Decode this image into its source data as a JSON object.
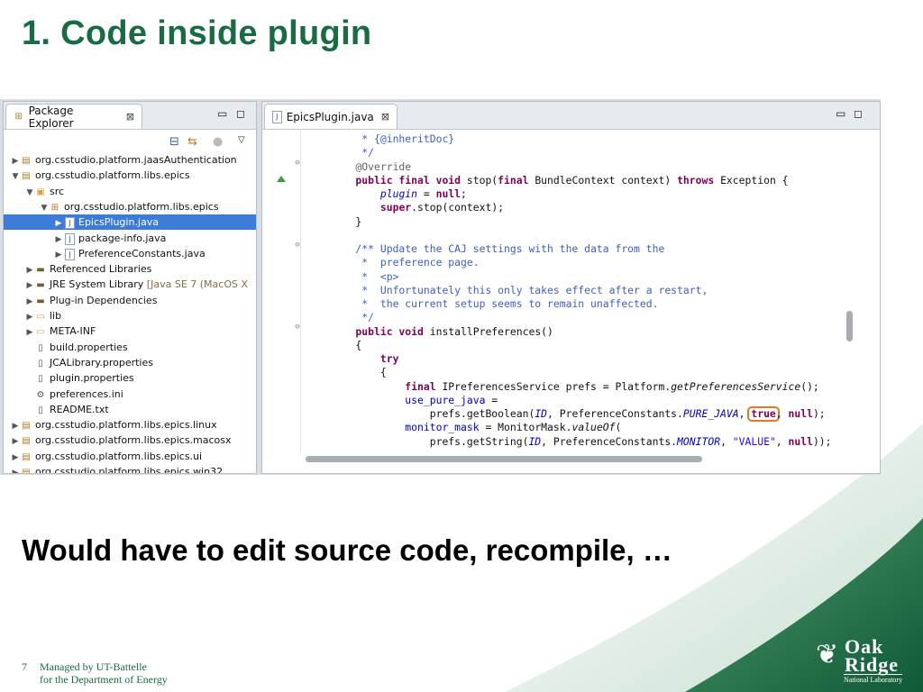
{
  "slide": {
    "title": "1. Code inside plugin",
    "bottom_text": "Would have to edit source code, recompile, …",
    "footer": {
      "page_number": "7",
      "line1": "Managed by UT-Battelle",
      "line2": "for the Department of Energy"
    },
    "logo": {
      "word1": "Oak",
      "word2": "Ridge",
      "subtitle": "National Laboratory"
    }
  },
  "colors": {
    "title_green": "#1a6b43",
    "selection_blue": "#3d7bd8",
    "highlight_orange": "#e8761e"
  },
  "package_explorer": {
    "tab_label": "Package Explorer",
    "close_glyph": "⊠",
    "tree": [
      {
        "label": "org.csstudio.platform.jaasAuthentication",
        "indent": 0,
        "expander": "▶",
        "icon": "plugin-project-icon"
      },
      {
        "label": "org.csstudio.platform.libs.epics",
        "indent": 0,
        "expander": "▼",
        "icon": "plugin-project-icon"
      },
      {
        "label": "src",
        "indent": 1,
        "expander": "▼",
        "icon": "source-folder-icon"
      },
      {
        "label": "org.csstudio.platform.libs.epics",
        "indent": 2,
        "expander": "▼",
        "icon": "package-icon"
      },
      {
        "label": "EpicsPlugin.java",
        "indent": 3,
        "expander": "▶",
        "icon": "java-file-icon",
        "selected": true
      },
      {
        "label": "package-info.java",
        "indent": 3,
        "expander": "▶",
        "icon": "java-file-icon"
      },
      {
        "label": "PreferenceConstants.java",
        "indent": 3,
        "expander": "▶",
        "icon": "java-file-icon"
      },
      {
        "label": "Referenced Libraries",
        "indent": 1,
        "expander": "▶",
        "icon": "library-icon"
      },
      {
        "label": "JRE System Library",
        "suffix": "[Java SE 7 (MacOS X",
        "indent": 1,
        "expander": "▶",
        "icon": "library-icon"
      },
      {
        "label": "Plug-in Dependencies",
        "indent": 1,
        "expander": "▶",
        "icon": "library-icon"
      },
      {
        "label": "lib",
        "indent": 1,
        "expander": "▶",
        "icon": "folder-icon"
      },
      {
        "label": "META-INF",
        "indent": 1,
        "expander": "▶",
        "icon": "folder-icon"
      },
      {
        "label": "build.properties",
        "indent": 1,
        "expander": "",
        "icon": "properties-file-icon"
      },
      {
        "label": "JCALibrary.properties",
        "indent": 1,
        "expander": "",
        "icon": "text-file-icon"
      },
      {
        "label": "plugin.properties",
        "indent": 1,
        "expander": "",
        "icon": "text-file-icon"
      },
      {
        "label": "preferences.ini",
        "indent": 1,
        "expander": "",
        "icon": "settings-file-icon"
      },
      {
        "label": "README.txt",
        "indent": 1,
        "expander": "",
        "icon": "text-file-icon"
      },
      {
        "label": "org.csstudio.platform.libs.epics.linux",
        "indent": 0,
        "expander": "▶",
        "icon": "plugin-project-icon"
      },
      {
        "label": "org.csstudio.platform.libs.epics.macosx",
        "indent": 0,
        "expander": "▶",
        "icon": "plugin-project-icon"
      },
      {
        "label": "org.csstudio.platform.libs.epics.ui",
        "indent": 0,
        "expander": "▶",
        "icon": "plugin-project-icon"
      },
      {
        "label": "org.csstudio.platform.libs.epics.win32",
        "indent": 0,
        "expander": "▶",
        "icon": "plugin-project-icon"
      }
    ]
  },
  "editor": {
    "tab_label": "EpicsPlugin.java",
    "close_glyph": "⊠",
    "code_lines": [
      [
        [
          "cm",
          "     * {@inheritDoc}"
        ]
      ],
      [
        [
          "cm",
          "     */"
        ]
      ],
      [
        [
          "an",
          "    @Override"
        ]
      ],
      [
        [
          "kw",
          "    public final void "
        ],
        [
          "",
          "stop("
        ],
        [
          "kw",
          "final "
        ],
        [
          "",
          "BundleContext context) "
        ],
        [
          "kw",
          "throws "
        ],
        [
          "",
          "Exception {"
        ]
      ],
      [
        [
          "",
          "        "
        ],
        [
          "fld it",
          "plugin"
        ],
        [
          "",
          " = "
        ],
        [
          "kw",
          "null"
        ],
        [
          "",
          ";"
        ]
      ],
      [
        [
          "",
          "        "
        ],
        [
          "kw",
          "super"
        ],
        [
          "",
          ".stop(context);"
        ]
      ],
      [
        [
          "",
          "    }"
        ]
      ],
      [
        [
          "",
          ""
        ]
      ],
      [
        [
          "cm",
          "    /** Update the CAJ settings with the data from the"
        ]
      ],
      [
        [
          "cm",
          "     *  preference page."
        ]
      ],
      [
        [
          "cm",
          "     *  <p>"
        ]
      ],
      [
        [
          "cm",
          "     *  Unfortunately this only takes effect after a restart,"
        ]
      ],
      [
        [
          "cm",
          "     *  the current setup seems to remain unaffected."
        ]
      ],
      [
        [
          "cm",
          "     */"
        ]
      ],
      [
        [
          "kw",
          "    public void "
        ],
        [
          "",
          "installPreferences()"
        ]
      ],
      [
        [
          "",
          "    {"
        ]
      ],
      [
        [
          "kw",
          "        try"
        ]
      ],
      [
        [
          "",
          "        {"
        ]
      ],
      [
        [
          "",
          "            "
        ],
        [
          "kw",
          "final "
        ],
        [
          "",
          "IPreferencesService prefs = Platform."
        ],
        [
          "it",
          "getPreferencesService"
        ],
        [
          "",
          "();"
        ]
      ],
      [
        [
          "",
          "            "
        ],
        [
          "fld",
          "use_pure_java"
        ],
        [
          "",
          " ="
        ]
      ],
      [
        [
          "",
          "                prefs.getBoolean("
        ],
        [
          "sfld",
          "ID"
        ],
        [
          "",
          ", PreferenceConstants."
        ],
        [
          "sfld",
          "PURE_JAVA"
        ],
        [
          "",
          ", "
        ],
        [
          "kw hl",
          "true"
        ],
        [
          "",
          ", "
        ],
        [
          "kw",
          "null"
        ],
        [
          "",
          ");"
        ]
      ],
      [
        [
          "",
          "            "
        ],
        [
          "fld",
          "monitor_mask"
        ],
        [
          "",
          " = MonitorMask."
        ],
        [
          "it",
          "valueOf"
        ],
        [
          "",
          "("
        ]
      ],
      [
        [
          "",
          "                prefs.getString("
        ],
        [
          "sfld",
          "ID"
        ],
        [
          "",
          ", PreferenceConstants."
        ],
        [
          "sfld",
          "MONITOR"
        ],
        [
          "",
          ", "
        ],
        [
          "st",
          "\"VALUE\""
        ],
        [
          "",
          ", "
        ],
        [
          "kw",
          "null"
        ],
        [
          "",
          "));"
        ]
      ]
    ]
  }
}
